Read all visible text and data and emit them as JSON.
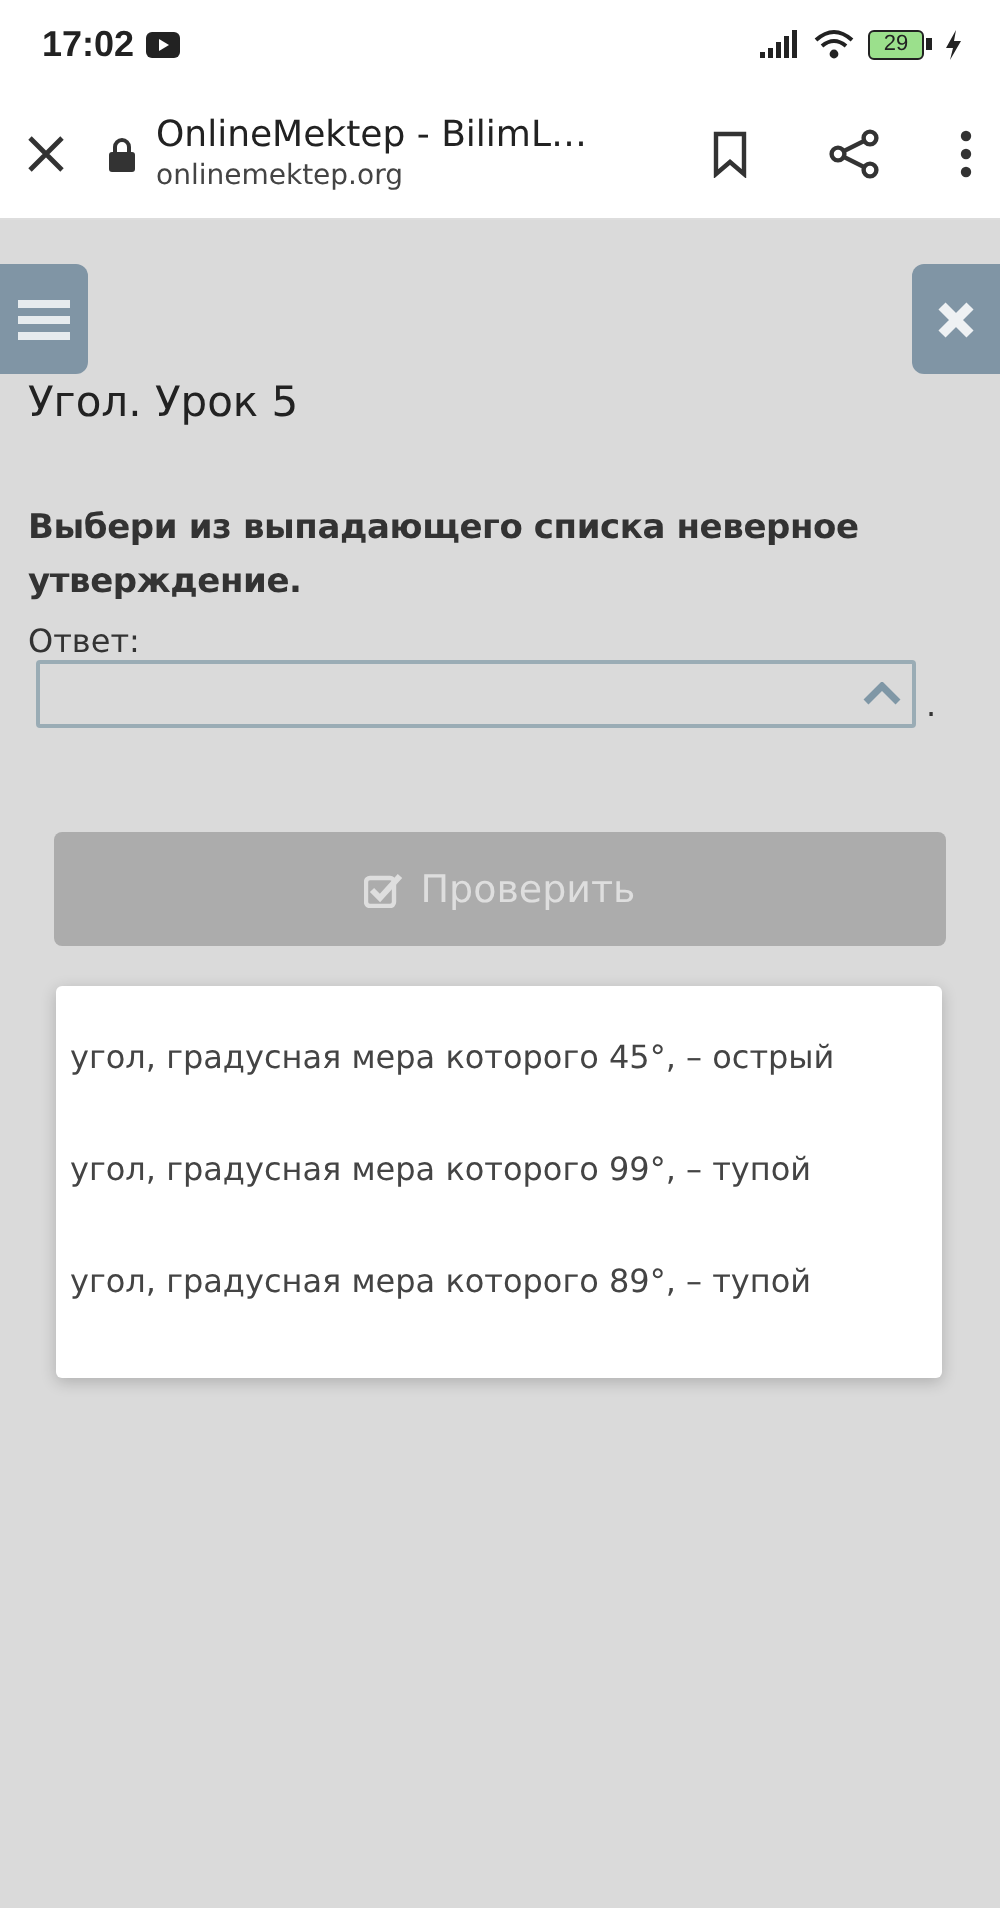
{
  "status_bar": {
    "time": "17:02",
    "battery": "29"
  },
  "browser": {
    "title": "OnlineMektep - BilimL…",
    "url": "onlinemektep.org"
  },
  "page": {
    "title": "Угол. Урок 5",
    "question": "Выбери из выпадающего списка неверное утверждение.",
    "answer_label": "Ответ:",
    "after_field": ".",
    "select": {
      "expanded": true,
      "options": [
        {
          "label": "угол, градусная мера которого 45°, – острый",
          "selected": false
        },
        {
          "label": "угол, градусная мера которого 99°, – тупой",
          "selected": false
        },
        {
          "label": "угол, градусная мера которого 89°, – тупой",
          "selected": false
        }
      ]
    },
    "check_button": {
      "label": "Проверить",
      "disabled": true
    }
  }
}
